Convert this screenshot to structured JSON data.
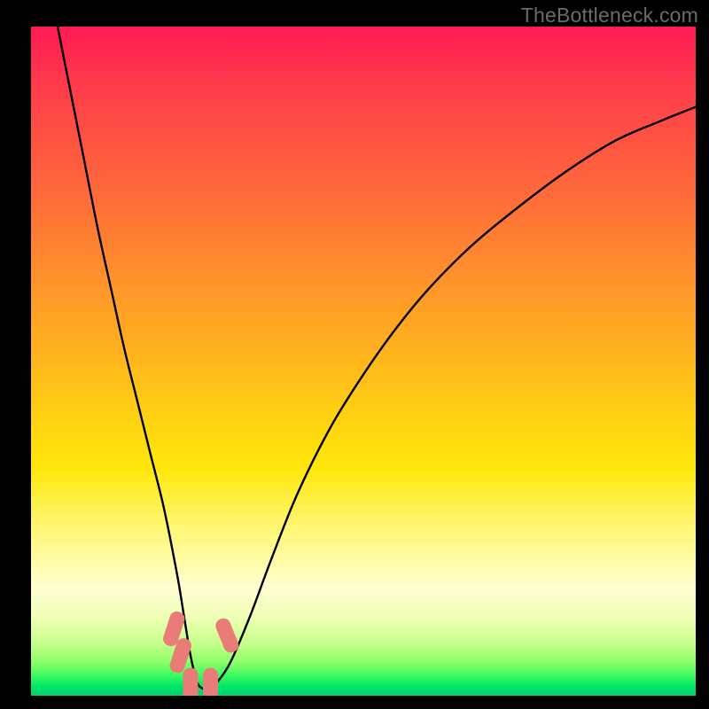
{
  "watermark": "TheBottleneck.com",
  "chart_data": {
    "type": "line",
    "title": "",
    "xlabel": "",
    "ylabel": "",
    "xlim": [
      0,
      100
    ],
    "ylim": [
      0,
      100
    ],
    "series": [
      {
        "name": "bottleneck-curve",
        "x": [
          4,
          6,
          8,
          10,
          12,
          14,
          16,
          18,
          20,
          22,
          23,
          24,
          25,
          26,
          27,
          28,
          30,
          33,
          36,
          40,
          45,
          50,
          55,
          60,
          66,
          72,
          80,
          88,
          95,
          100
        ],
        "values": [
          100,
          90,
          80,
          70,
          61,
          52,
          44,
          36,
          28,
          18,
          12,
          6,
          2,
          1,
          1,
          2,
          5,
          12,
          20,
          30,
          40,
          48,
          55,
          61,
          67,
          72,
          78,
          83,
          86,
          88
        ]
      }
    ],
    "markers": [
      {
        "name": "marker-left-1",
        "x": 21.5,
        "y": 10
      },
      {
        "name": "marker-left-2",
        "x": 22.5,
        "y": 6
      },
      {
        "name": "marker-bottom-1",
        "x": 24.0,
        "y": 1.5
      },
      {
        "name": "marker-bottom-2",
        "x": 27.0,
        "y": 1.5
      },
      {
        "name": "marker-right-1",
        "x": 29.5,
        "y": 9
      }
    ],
    "marker_color": "#e97b78",
    "curve_color": "#000000",
    "background_gradient": [
      "#ff1a54",
      "#ffd012",
      "#00cf6e"
    ]
  }
}
